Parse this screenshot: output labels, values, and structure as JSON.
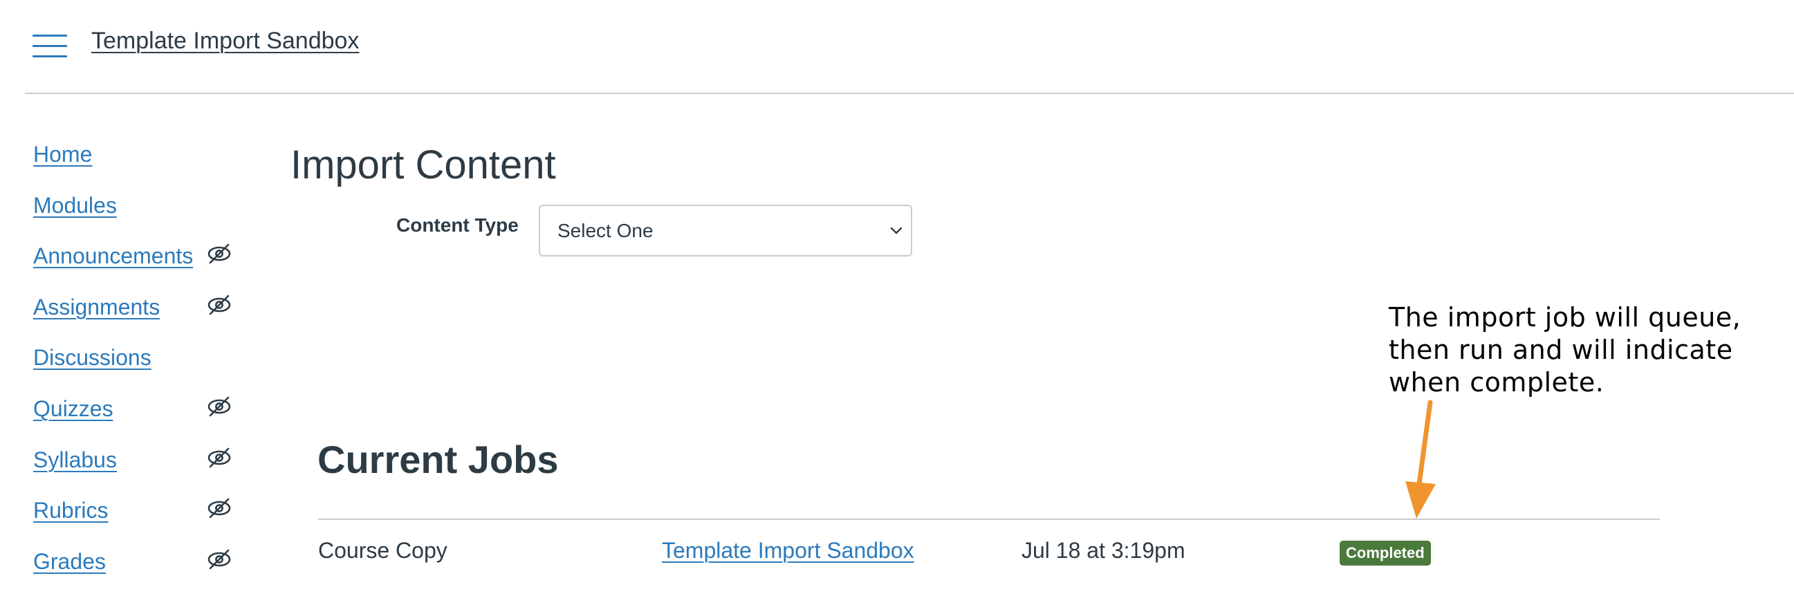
{
  "header": {
    "menu_icon": "hamburger-menu-icon",
    "course_title": "Template Import Sandbox"
  },
  "sidebar": {
    "items": [
      {
        "label": "Home",
        "hidden": false
      },
      {
        "label": "Modules",
        "hidden": false
      },
      {
        "label": "Announcements",
        "hidden": true
      },
      {
        "label": "Assignments",
        "hidden": true
      },
      {
        "label": "Discussions",
        "hidden": false
      },
      {
        "label": "Quizzes",
        "hidden": true
      },
      {
        "label": "Syllabus",
        "hidden": true
      },
      {
        "label": "Rubrics",
        "hidden": true
      },
      {
        "label": "Grades",
        "hidden": true
      }
    ],
    "hidden_icon": "eye-slash-icon"
  },
  "main": {
    "title": "Import Content",
    "content_type_label": "Content Type",
    "content_type_value": "Select One",
    "annotation": "The import job will queue, then run and will indicate when complete.",
    "jobs": {
      "title": "Current Jobs",
      "rows": [
        {
          "type": "Course Copy",
          "source": "Template Import Sandbox",
          "date": "Jul 18 at 3:19pm",
          "status": "Completed"
        }
      ]
    }
  },
  "colors": {
    "link": "#2b7abc",
    "text": "#2d3b45",
    "status_completed": "#4a7a3c",
    "annotation_arrow": "#f0942f"
  }
}
